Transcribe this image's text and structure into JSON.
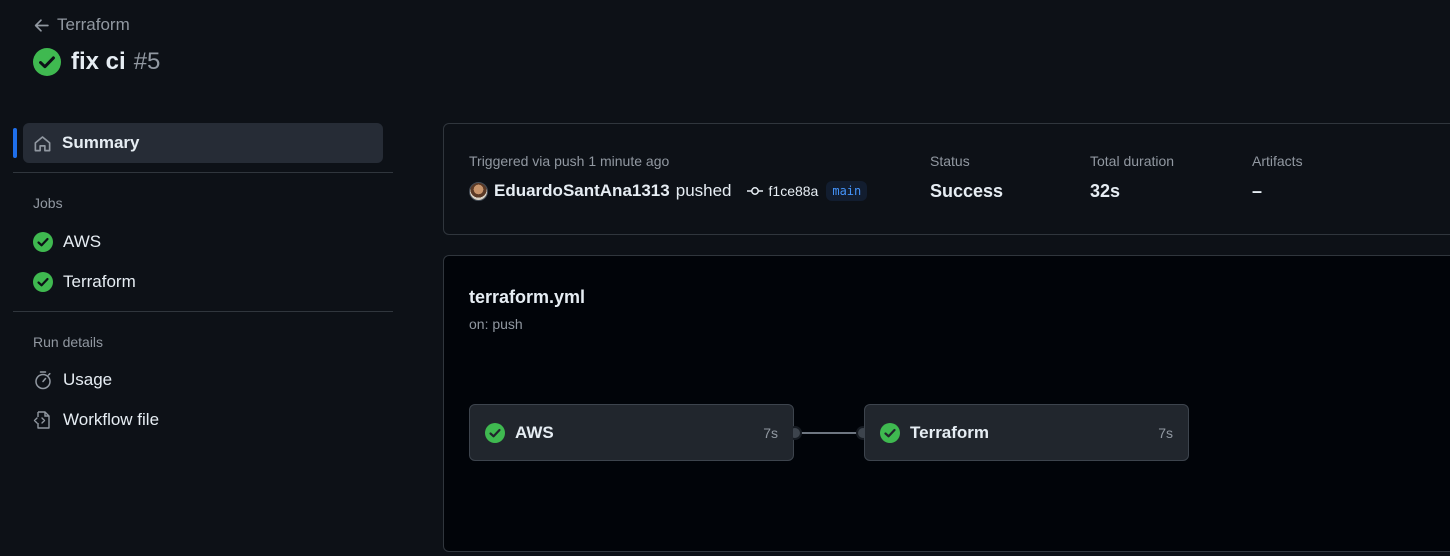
{
  "header": {
    "back_label": "Terraform",
    "run_title": "fix ci",
    "run_number": "#5"
  },
  "sidebar": {
    "summary_label": "Summary",
    "jobs_section": "Jobs",
    "jobs": [
      {
        "label": "AWS",
        "icon": "check-circle-icon"
      },
      {
        "label": "Terraform",
        "icon": "check-circle-icon"
      }
    ],
    "run_details_section": "Run details",
    "run_details": [
      {
        "label": "Usage",
        "icon": "stopwatch-icon"
      },
      {
        "label": "Workflow file",
        "icon": "file-code-icon"
      }
    ]
  },
  "summary": {
    "trigger_text": "Triggered via push 1 minute ago",
    "actor": "EduardoSantAna1313",
    "action": "pushed",
    "commit_sha": "f1ce88a",
    "branch": "main",
    "status_label": "Status",
    "status_value": "Success",
    "duration_label": "Total duration",
    "duration_value": "32s",
    "artifacts_label": "Artifacts",
    "artifacts_value": "–"
  },
  "workflow": {
    "file_name": "terraform.yml",
    "trigger": "on: push",
    "jobs": [
      {
        "label": "AWS",
        "duration": "7s"
      },
      {
        "label": "Terraform",
        "duration": "7s"
      }
    ]
  },
  "colors": {
    "background": "#0d1117",
    "success": "#3fb950",
    "accent": "#1f6feb",
    "branch": "#4493f8"
  }
}
